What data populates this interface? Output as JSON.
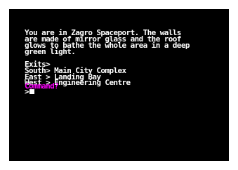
{
  "colors": {
    "background": "#000000",
    "text": "#ffffff",
    "prompt": "#ff00ff",
    "border": "#ffffff"
  },
  "description_lines": [
    "You are in Zagro Spaceport. The walls",
    "are made of mirror glass and the roof",
    "glows to bathe the whole area in a deep",
    "green light."
  ],
  "exits": {
    "heading": "Exits>",
    "items": [
      "South> Main City Complex",
      "East > Landing Bay",
      "West > Engineering Centre"
    ]
  },
  "command": {
    "label": "Command?",
    "prompt_symbol": ">",
    "input_value": ""
  }
}
